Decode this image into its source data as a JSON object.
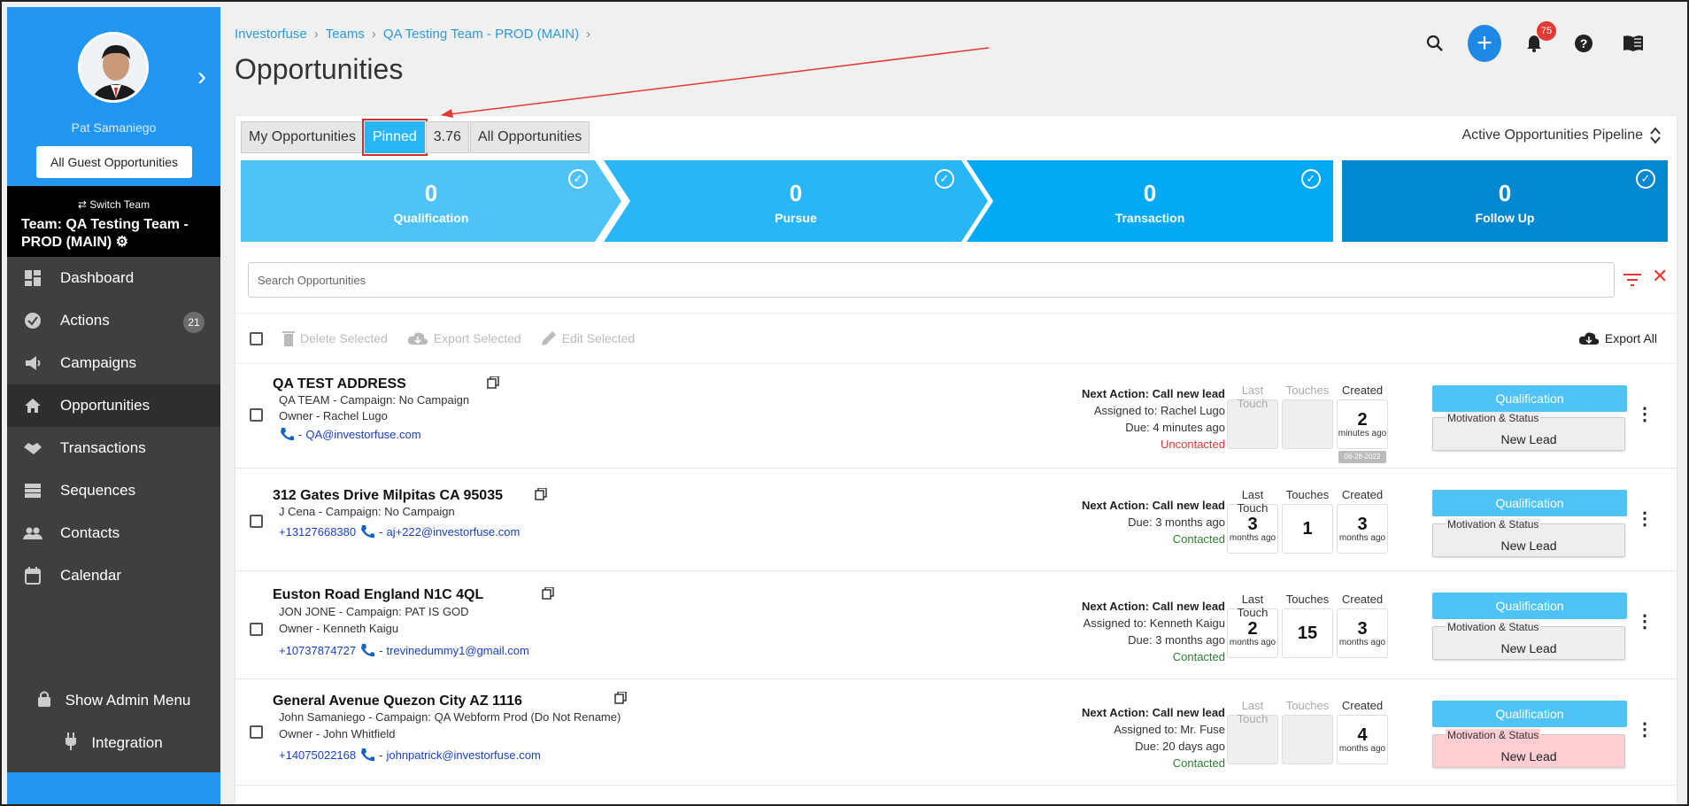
{
  "sidebar": {
    "user_name": "Pat Samaniego",
    "guest_button": "All Guest Opportunities",
    "switch_team": "Switch Team",
    "team_label": "Team: QA Testing Team - PROD (MAIN)",
    "items": [
      {
        "label": "Dashboard",
        "icon": "dashboard-icon"
      },
      {
        "label": "Actions",
        "icon": "check-circle-icon",
        "count": "21"
      },
      {
        "label": "Campaigns",
        "icon": "megaphone-icon"
      },
      {
        "label": "Opportunities",
        "icon": "home-icon"
      },
      {
        "label": "Transactions",
        "icon": "handshake-icon"
      },
      {
        "label": "Sequences",
        "icon": "sequence-icon"
      },
      {
        "label": "Contacts",
        "icon": "people-icon"
      },
      {
        "label": "Calendar",
        "icon": "calendar-icon"
      }
    ],
    "admin_menu": "Show Admin Menu",
    "integration": "Integration"
  },
  "header": {
    "breadcrumb": [
      "Investorfuse",
      "Teams",
      "QA Testing Team - PROD (MAIN)"
    ],
    "title": "Opportunities",
    "notification_count": "75"
  },
  "tabs": [
    "My Opportunities",
    "Pinned",
    "3.76",
    "All Opportunities"
  ],
  "pipeline_select": "Active Opportunities Pipeline",
  "stages": [
    {
      "count": "0",
      "label": "Qualification",
      "color": "#4fc3f7"
    },
    {
      "count": "0",
      "label": "Pursue",
      "color": "#29b6f6"
    },
    {
      "count": "0",
      "label": "Transaction",
      "color": "#03a9f4"
    },
    {
      "count": "0",
      "label": "Follow Up",
      "color": "#0288d1"
    }
  ],
  "search": {
    "placeholder": "Search Opportunities"
  },
  "bulk": {
    "delete": "Delete Selected",
    "export": "Export Selected",
    "edit": "Edit Selected",
    "export_all": "Export All"
  },
  "stat_headers": {
    "last_touch": "Last Touch",
    "touches": "Touches",
    "created": "Created"
  },
  "status_label": "Motivation & Status",
  "rows": [
    {
      "address": "QA TEST ADDRESS",
      "campaign": "QA TEAM - Campaign: No Campaign",
      "owner": "Owner - Rachel Lugo",
      "phone": "",
      "email": "QA@investorfuse.com",
      "next_action": "Next Action: Call new lead",
      "assigned": "Assigned to: Rachel Lugo",
      "due": "Due: 4 minutes ago",
      "contact_status": "Uncontacted",
      "last_touch_num": "",
      "last_touch_unit": "",
      "touches": "",
      "created_num": "2",
      "created_unit": "minutes ago",
      "created_date": "06-28-2022",
      "stage": "Qualification",
      "status": "New Lead"
    },
    {
      "address": "312 Gates Drive Milpitas CA 95035",
      "campaign": "J Cena - Campaign: No Campaign",
      "owner": "",
      "phone": "+13127668380",
      "email": "aj+222@investorfuse.com",
      "next_action": "Next Action: Call new lead",
      "assigned": "",
      "due": "Due: 3 months ago",
      "contact_status": "Contacted",
      "last_touch_num": "3",
      "last_touch_unit": "months ago",
      "touches": "1",
      "created_num": "3",
      "created_unit": "months ago",
      "created_date": "",
      "stage": "Qualification",
      "status": "New Lead"
    },
    {
      "address": "Euston Road England N1C 4QL",
      "campaign": "JON JONE - Campaign: PAT IS GOD",
      "owner": "Owner - Kenneth Kaigu",
      "phone": "+10737874727",
      "email": "trevinedummy1@gmail.com",
      "next_action": "Next Action: Call new lead",
      "assigned": "Assigned to: Kenneth Kaigu",
      "due": "Due: 3 months ago",
      "contact_status": "Contacted",
      "last_touch_num": "2",
      "last_touch_unit": "months ago",
      "touches": "15",
      "created_num": "3",
      "created_unit": "months ago",
      "created_date": "",
      "stage": "Qualification",
      "status": "New Lead"
    },
    {
      "address": "General Avenue Quezon City AZ 1116",
      "campaign": "John Samaniego - Campaign: QA Webform Prod (Do Not Rename)",
      "owner": "Owner - John Whitfield",
      "phone": "+14075022168",
      "email": "johnpatrick@investorfuse.com",
      "next_action": "Next Action: Call new lead",
      "assigned": "Assigned to: Mr. Fuse",
      "due": "Due: 20 days ago",
      "contact_status": "Contacted",
      "last_touch_num": "",
      "last_touch_unit": "",
      "touches": "",
      "created_num": "4",
      "created_unit": "months ago",
      "created_date": "",
      "stage": "Qualification",
      "status": "New Lead"
    }
  ]
}
